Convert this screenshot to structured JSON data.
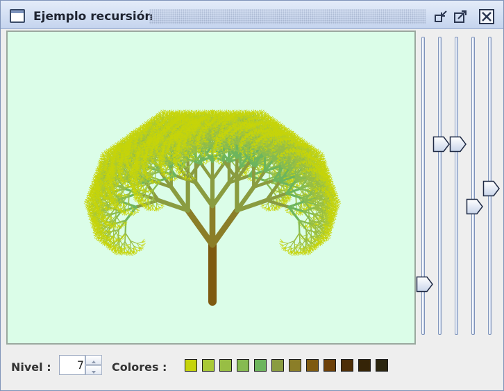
{
  "window": {
    "title": "Ejemplo recursión",
    "icon": "window-icon",
    "buttons": [
      "iconify-icon",
      "maximize-icon",
      "close-icon"
    ]
  },
  "canvas": {
    "background": "#dbfde8",
    "tree": {
      "levels": 7,
      "trunk_color": "#7a5c14",
      "leaf_color": "#c8d40e"
    }
  },
  "sliders": [
    {
      "name": "slider-1",
      "value": 0.17
    },
    {
      "name": "slider-2",
      "value": 0.64
    },
    {
      "name": "slider-3",
      "value": 0.64
    },
    {
      "name": "slider-4",
      "value": 0.43
    },
    {
      "name": "slider-5",
      "value": 0.49
    }
  ],
  "controls": {
    "nivel_label": "Nivel :",
    "nivel_value": "7",
    "colores_label": "Colores :"
  },
  "colors": [
    "#c6d40a",
    "#a9c937",
    "#98be44",
    "#86bb51",
    "#6db55d",
    "#8a9c40",
    "#8b7e28",
    "#7e5a10",
    "#6c3f07",
    "#4e2e07",
    "#352407",
    "#2b2610"
  ]
}
